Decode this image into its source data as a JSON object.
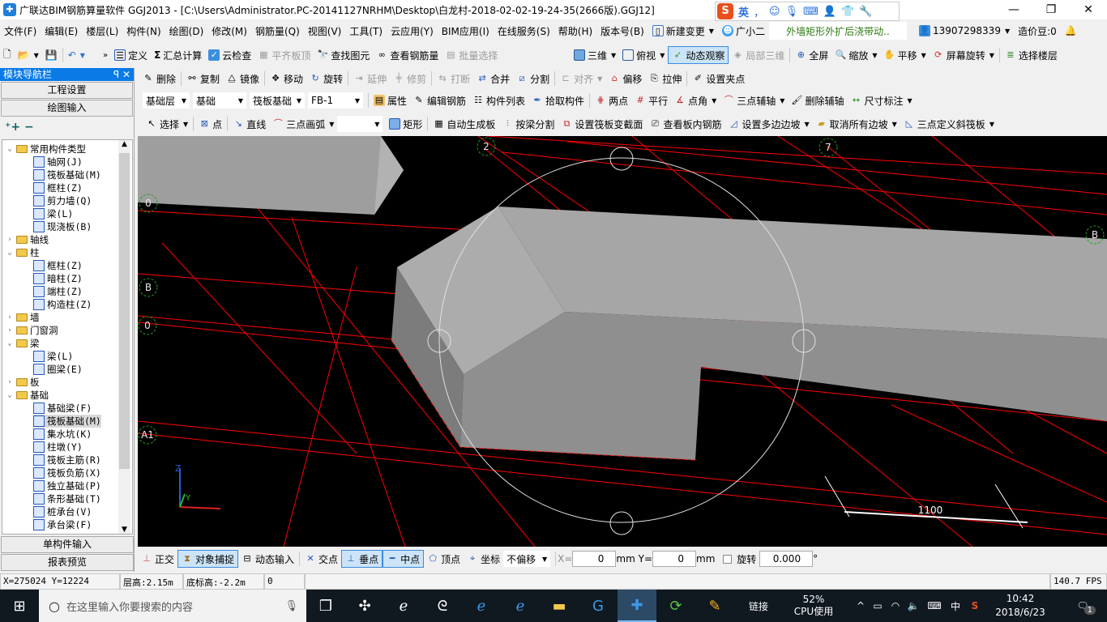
{
  "window": {
    "title": "广联达BIM钢筋算量软件 GGJ2013 - [C:\\Users\\Administrator.PC-20141127NRHM\\Desktop\\白龙村-2018-02-02-19-24-35(2666版).GGJ12]",
    "minimize": "—",
    "maximize": "❐",
    "close": "✕"
  },
  "ime": {
    "logo": "S",
    "lang": "英",
    "punct": "，",
    "icons": [
      "emoji-icon",
      "mic-icon",
      "keyboard-icon",
      "user-icon",
      "shirt-icon",
      "wrench-icon"
    ]
  },
  "menu": [
    "文件(F)",
    "编辑(E)",
    "楼层(L)",
    "构件(N)",
    "绘图(D)",
    "修改(M)",
    "钢筋量(Q)",
    "视图(V)",
    "工具(T)",
    "云应用(Y)",
    "BIM应用(I)",
    "在线服务(S)",
    "帮助(H)",
    "版本号(B)"
  ],
  "menu_extra": {
    "new_change": "新建变更",
    "assistant": "广小二",
    "notice": "外墙矩形外扩后浇带动..",
    "account": "13907298339",
    "beans": "造价豆:0"
  },
  "toolbar1": {
    "items": [
      "定义",
      "汇总计算",
      "云检查",
      "平齐板顶",
      "查找图元",
      "查看钢筋量",
      "批量选择"
    ],
    "view": [
      "三维",
      "俯视",
      "动态观察",
      "局部三维",
      "全屏",
      "缩放",
      "平移",
      "屏幕旋转",
      "选择楼层"
    ]
  },
  "toolbar2": [
    "删除",
    "复制",
    "镜像",
    "移动",
    "旋转",
    "延伸",
    "修剪",
    "打断",
    "合并",
    "分割",
    "对齐",
    "偏移",
    "拉伸",
    "设置夹点"
  ],
  "toolbar3": {
    "combos": [
      "基础层",
      "基础",
      "筏板基础",
      "FB-1"
    ],
    "items": [
      "属性",
      "编辑钢筋",
      "构件列表",
      "拾取构件",
      "两点",
      "平行",
      "点角",
      "三点辅轴",
      "删除辅轴",
      "尺寸标注"
    ]
  },
  "toolbar4": [
    "选择",
    "点",
    "直线",
    "三点画弧",
    "矩形",
    "自动生成板",
    "按梁分割",
    "设置筏板变截面",
    "查看板内钢筋",
    "设置多边边坡",
    "取消所有边坡",
    "三点定义斜筏板"
  ],
  "sidebar": {
    "title": "模块导航栏",
    "pin": "ꟼ",
    "close": "✕",
    "btn_project": "工程设置",
    "btn_draw": "绘图输入",
    "btn_single": "单构件输入",
    "btn_report": "报表预览",
    "tree": [
      {
        "label": "常用构件类型",
        "level": 0,
        "folder": true,
        "open": true
      },
      {
        "label": "轴网(J)",
        "level": 1
      },
      {
        "label": "筏板基础(M)",
        "level": 1
      },
      {
        "label": "框柱(Z)",
        "level": 1
      },
      {
        "label": "剪力墙(Q)",
        "level": 1
      },
      {
        "label": "梁(L)",
        "level": 1
      },
      {
        "label": "现浇板(B)",
        "level": 1
      },
      {
        "label": "轴线",
        "level": 0,
        "folder": true,
        "open": false
      },
      {
        "label": "柱",
        "level": 0,
        "folder": true,
        "open": true
      },
      {
        "label": "框柱(Z)",
        "level": 1
      },
      {
        "label": "暗柱(Z)",
        "level": 1
      },
      {
        "label": "端柱(Z)",
        "level": 1
      },
      {
        "label": "构造柱(Z)",
        "level": 1
      },
      {
        "label": "墙",
        "level": 0,
        "folder": true,
        "open": false
      },
      {
        "label": "门窗洞",
        "level": 0,
        "folder": true,
        "open": false
      },
      {
        "label": "梁",
        "level": 0,
        "folder": true,
        "open": true
      },
      {
        "label": "梁(L)",
        "level": 1
      },
      {
        "label": "圈梁(E)",
        "level": 1
      },
      {
        "label": "板",
        "level": 0,
        "folder": true,
        "open": false
      },
      {
        "label": "基础",
        "level": 0,
        "folder": true,
        "open": true
      },
      {
        "label": "基础梁(F)",
        "level": 1
      },
      {
        "label": "筏板基础(M)",
        "level": 1,
        "selected": true
      },
      {
        "label": "集水坑(K)",
        "level": 1
      },
      {
        "label": "柱墩(Y)",
        "level": 1
      },
      {
        "label": "筏板主筋(R)",
        "level": 1
      },
      {
        "label": "筏板负筋(X)",
        "level": 1
      },
      {
        "label": "独立基础(P)",
        "level": 1
      },
      {
        "label": "条形基础(T)",
        "level": 1
      },
      {
        "label": "桩承台(V)",
        "level": 1
      },
      {
        "label": "承台梁(F)",
        "level": 1
      }
    ]
  },
  "viewport": {
    "axis_labels": [
      "2",
      "7",
      "B",
      "B",
      "0",
      "A1",
      "0"
    ],
    "dimension": "1100",
    "gizmo": {
      "z": "Z",
      "y": "Y"
    }
  },
  "bottombar": {
    "items": [
      "正交",
      "对象捕捉",
      "动态输入",
      "交点",
      "垂点",
      "中点",
      "顶点",
      "坐标"
    ],
    "offset": "不偏移",
    "x_label": "X=",
    "x": "0",
    "y_label": "Y=",
    "y": "0",
    "unit": "mm",
    "rotate": "旋转",
    "angle": "0.000",
    "deg": "°"
  },
  "status": {
    "coords": "X=275024 Y=12224",
    "floor_height": "层高:2.15m",
    "bottom_elev": "底标高:-2.2m",
    "value": "0",
    "fps": "140.7 FPS"
  },
  "taskbar": {
    "search": "在这里输入你要搜索的内容",
    "link": "链接",
    "cpu_pct": "52%",
    "cpu_label": "CPU使用",
    "lang": "中",
    "time": "10:42",
    "date": "2018/6/23",
    "notifications": "1"
  },
  "colors": {
    "viewport_bg": "#000000",
    "grid_line": "#ff0000",
    "accent": "#0a7ae6",
    "beam_top": "#a9a9a9",
    "beam_front": "#8e8e8e"
  }
}
